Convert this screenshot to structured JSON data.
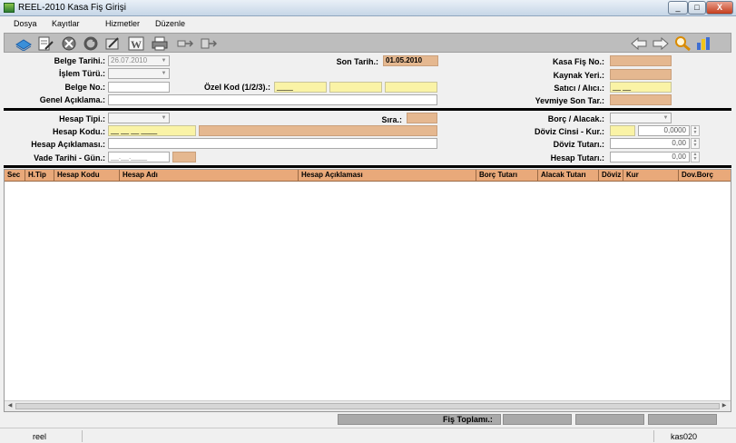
{
  "window": {
    "title": "REEL-2010 Kasa Fiş Girişi",
    "minimize": "_",
    "maximize": "□",
    "close": "X"
  },
  "menu": {
    "items": [
      "Dosya",
      "Kayıtlar",
      "Hizmetler",
      "Düzenle"
    ]
  },
  "toolbar": {
    "icons": [
      "new-record-icon",
      "edit-document-icon",
      "delete-icon",
      "refresh-icon",
      "edit-icon",
      "word-icon",
      "print-icon",
      "export-icon",
      "transfer-icon",
      "previous-arrow-icon",
      "next-arrow-icon",
      "search-icon",
      "bar-chart-icon"
    ],
    "word_letter": "W"
  },
  "header": {
    "belge_tarihi": {
      "label": "Belge Tarihi.:",
      "value": "26.07.2010"
    },
    "islem_turu": {
      "label": "İşlem Türü.:",
      "value": ""
    },
    "belge_no": {
      "label": "Belge No.:",
      "value": ""
    },
    "genel_aciklama": {
      "label": "Genel Açıklama.:",
      "value": ""
    },
    "son_tarih": {
      "label": "Son Tarih.:",
      "value": "01.05.2010"
    },
    "ozel_kod": {
      "label": "Özel Kod (1/2/3).:",
      "values": [
        "____",
        "",
        ""
      ]
    },
    "kasa_fis_no": {
      "label": "Kasa Fiş No.:",
      "value": ""
    },
    "kaynak_yeri": {
      "label": "Kaynak Yeri.:",
      "value": ""
    },
    "satici_alici": {
      "label": "Satıcı / Alıcı.:",
      "value": "__ __"
    },
    "yevmiye_son_tar": {
      "label": "Yevmiye Son Tar.:",
      "value": ""
    }
  },
  "detail": {
    "hesap_tipi": {
      "label": "Hesap Tipi.:",
      "value": ""
    },
    "hesap_kodu": {
      "label": "Hesap Kodu.:",
      "value": "__ __ __ ____"
    },
    "hesap_aciklamasi": {
      "label": "Hesap Açıklaması.:",
      "value": ""
    },
    "vade_tarihi_gun": {
      "label": "Vade Tarihi - Gün.:",
      "value": "__.__.____"
    },
    "sira": {
      "label": "Sıra.:",
      "value": ""
    },
    "borc_alacak": {
      "label": "Borç / Alacak.:",
      "value": ""
    },
    "doviz_cinsi_kur": {
      "label": "Döviz Cinsi - Kur.:",
      "value": "0,0000"
    },
    "doviz_tutari": {
      "label": "Döviz Tutarı.:",
      "value": "0,00"
    },
    "hesap_tutari": {
      "label": "Hesap Tutarı.:",
      "value": "0,00"
    }
  },
  "grid": {
    "columns": [
      "Sec",
      "H.Tip",
      "Hesap Kodu",
      "Hesap Adı",
      "Hesap Açıklaması",
      "Borç Tutarı",
      "Alacak Tutarı",
      "Döviz",
      "Kur",
      "Dov.Borç"
    ],
    "rows": []
  },
  "footer": {
    "fis_toplami_label": "Fiş Toplamı.:"
  },
  "status": {
    "left": "reel",
    "right": "kas020"
  }
}
